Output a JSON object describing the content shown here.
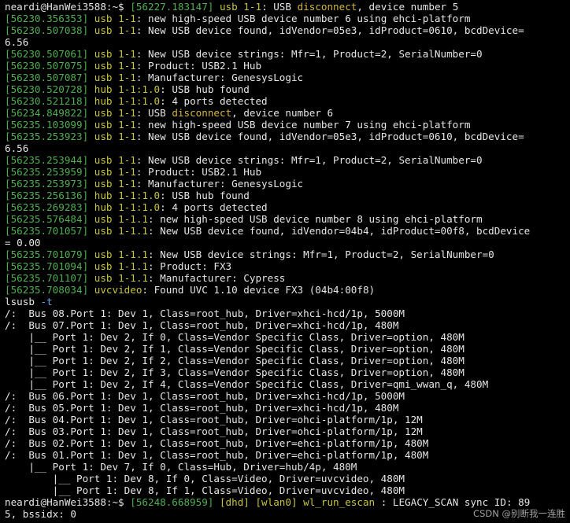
{
  "colors": {
    "background": "#000000",
    "text": "#e6e6e6",
    "timestamp": "#4fae4f",
    "subsystem": "#c8c43a",
    "warning": "#d3b53a",
    "option": "#5aa7e6"
  },
  "terminal": {
    "lines": [
      {
        "kind": "log",
        "segments": [
          {
            "t": "neardi@HanWei3588:~$ ",
            "c": "prompt"
          },
          {
            "t": "[56227.183147]",
            "c": "ts"
          },
          {
            "t": " usb 1-1",
            "c": "sub"
          },
          {
            "t": ": USB ",
            "c": "text"
          },
          {
            "t": "disconnect",
            "c": "warn"
          },
          {
            "t": ", device number 5",
            "c": "text"
          }
        ]
      },
      {
        "kind": "log",
        "segments": [
          {
            "t": "[56230.356353]",
            "c": "ts"
          },
          {
            "t": " usb 1-1",
            "c": "sub"
          },
          {
            "t": ": new high-speed USB device number 6 using ehci-platform",
            "c": "text"
          }
        ]
      },
      {
        "kind": "log",
        "segments": [
          {
            "t": "[56230.507038]",
            "c": "ts"
          },
          {
            "t": " usb 1-1",
            "c": "sub"
          },
          {
            "t": ": New USB device found, idVendor=05e3, idProduct=0610, bcdDevice=",
            "c": "text"
          }
        ]
      },
      {
        "kind": "log",
        "segments": [
          {
            "t": "6.56",
            "c": "text"
          }
        ]
      },
      {
        "kind": "log",
        "segments": [
          {
            "t": "[56230.507061]",
            "c": "ts"
          },
          {
            "t": " usb 1-1",
            "c": "sub"
          },
          {
            "t": ": New USB device strings: Mfr=1, Product=2, SerialNumber=0",
            "c": "text"
          }
        ]
      },
      {
        "kind": "log",
        "segments": [
          {
            "t": "[56230.507075]",
            "c": "ts"
          },
          {
            "t": " usb 1-1",
            "c": "sub"
          },
          {
            "t": ": Product: USB2.1 Hub",
            "c": "text"
          }
        ]
      },
      {
        "kind": "log",
        "segments": [
          {
            "t": "[56230.507087]",
            "c": "ts"
          },
          {
            "t": " usb 1-1",
            "c": "sub"
          },
          {
            "t": ": Manufacturer: GenesysLogic",
            "c": "text"
          }
        ]
      },
      {
        "kind": "log",
        "segments": [
          {
            "t": "[56230.520728]",
            "c": "ts"
          },
          {
            "t": " hub 1-1:1.0",
            "c": "sub"
          },
          {
            "t": ": USB hub found",
            "c": "text"
          }
        ]
      },
      {
        "kind": "log",
        "segments": [
          {
            "t": "[56230.521218]",
            "c": "ts"
          },
          {
            "t": " hub 1-1:1.0",
            "c": "sub"
          },
          {
            "t": ": 4 ports detected",
            "c": "text"
          }
        ]
      },
      {
        "kind": "log",
        "segments": [
          {
            "t": "[56234.849822]",
            "c": "ts"
          },
          {
            "t": " usb 1-1",
            "c": "sub"
          },
          {
            "t": ": USB ",
            "c": "text"
          },
          {
            "t": "disconnect",
            "c": "warn"
          },
          {
            "t": ", device number 6",
            "c": "text"
          }
        ]
      },
      {
        "kind": "log",
        "segments": [
          {
            "t": "[56235.103099]",
            "c": "ts"
          },
          {
            "t": " usb 1-1",
            "c": "sub"
          },
          {
            "t": ": new high-speed USB device number 7 using ehci-platform",
            "c": "text"
          }
        ]
      },
      {
        "kind": "log",
        "segments": [
          {
            "t": "[56235.253923]",
            "c": "ts"
          },
          {
            "t": " usb 1-1",
            "c": "sub"
          },
          {
            "t": ": New USB device found, idVendor=05e3, idProduct=0610, bcdDevice=",
            "c": "text"
          }
        ]
      },
      {
        "kind": "log",
        "segments": [
          {
            "t": "6.56",
            "c": "text"
          }
        ]
      },
      {
        "kind": "log",
        "segments": [
          {
            "t": "[56235.253944]",
            "c": "ts"
          },
          {
            "t": " usb 1-1",
            "c": "sub"
          },
          {
            "t": ": New USB device strings: Mfr=1, Product=2, SerialNumber=0",
            "c": "text"
          }
        ]
      },
      {
        "kind": "log",
        "segments": [
          {
            "t": "[56235.253959]",
            "c": "ts"
          },
          {
            "t": " usb 1-1",
            "c": "sub"
          },
          {
            "t": ": Product: USB2.1 Hub",
            "c": "text"
          }
        ]
      },
      {
        "kind": "log",
        "segments": [
          {
            "t": "[56235.253973]",
            "c": "ts"
          },
          {
            "t": " usb 1-1",
            "c": "sub"
          },
          {
            "t": ": Manufacturer: GenesysLogic",
            "c": "text"
          }
        ]
      },
      {
        "kind": "log",
        "segments": [
          {
            "t": "[56235.256136]",
            "c": "ts"
          },
          {
            "t": " hub 1-1:1.0",
            "c": "sub"
          },
          {
            "t": ": USB hub found",
            "c": "text"
          }
        ]
      },
      {
        "kind": "log",
        "segments": [
          {
            "t": "[56235.269283]",
            "c": "ts"
          },
          {
            "t": " hub 1-1:1.0",
            "c": "sub"
          },
          {
            "t": ": 4 ports detected",
            "c": "text"
          }
        ]
      },
      {
        "kind": "log",
        "segments": [
          {
            "t": "[56235.576484]",
            "c": "ts"
          },
          {
            "t": " usb 1-1.1",
            "c": "sub"
          },
          {
            "t": ": new high-speed USB device number 8 using ehci-platform",
            "c": "text"
          }
        ]
      },
      {
        "kind": "log",
        "segments": [
          {
            "t": "[56235.701057]",
            "c": "ts"
          },
          {
            "t": " usb 1-1.1",
            "c": "sub"
          },
          {
            "t": ": New USB device found, idVendor=04b4, idProduct=00f8, bcdDevice",
            "c": "text"
          }
        ]
      },
      {
        "kind": "log",
        "segments": [
          {
            "t": "= 0.00",
            "c": "text"
          }
        ]
      },
      {
        "kind": "log",
        "segments": [
          {
            "t": "[56235.701079]",
            "c": "ts"
          },
          {
            "t": " usb 1-1.1",
            "c": "sub"
          },
          {
            "t": ": New USB device strings: Mfr=1, Product=2, SerialNumber=0",
            "c": "text"
          }
        ]
      },
      {
        "kind": "log",
        "segments": [
          {
            "t": "[56235.701094]",
            "c": "ts"
          },
          {
            "t": " usb 1-1.1",
            "c": "sub"
          },
          {
            "t": ": Product: FX3",
            "c": "text"
          }
        ]
      },
      {
        "kind": "log",
        "segments": [
          {
            "t": "[56235.701107]",
            "c": "ts"
          },
          {
            "t": " usb 1-1.1",
            "c": "sub"
          },
          {
            "t": ": Manufacturer: Cypress",
            "c": "text"
          }
        ]
      },
      {
        "kind": "log",
        "segments": [
          {
            "t": "[56235.708034]",
            "c": "ts"
          },
          {
            "t": " uvcvideo",
            "c": "sub"
          },
          {
            "t": ": Found UVC 1.10 device FX3 (04b4:00f8)",
            "c": "text"
          }
        ]
      },
      {
        "kind": "cmd",
        "segments": [
          {
            "t": "lsusb ",
            "c": "text"
          },
          {
            "t": "-t",
            "c": "opt"
          }
        ]
      },
      {
        "kind": "out",
        "segments": [
          {
            "t": "/:  Bus 08.Port 1: Dev 1, Class=root_hub, Driver=xhci-hcd/1p, 5000M",
            "c": "text"
          }
        ]
      },
      {
        "kind": "out",
        "segments": [
          {
            "t": "/:  Bus 07.Port 1: Dev 1, Class=root_hub, Driver=xhci-hcd/1p, 480M",
            "c": "text"
          }
        ]
      },
      {
        "kind": "out",
        "segments": [
          {
            "t": "    |__ Port 1: Dev 2, If 0, Class=Vendor Specific Class, Driver=option, 480M",
            "c": "text"
          }
        ]
      },
      {
        "kind": "out",
        "segments": [
          {
            "t": "    |__ Port 1: Dev 2, If 1, Class=Vendor Specific Class, Driver=option, 480M",
            "c": "text"
          }
        ]
      },
      {
        "kind": "out",
        "segments": [
          {
            "t": "    |__ Port 1: Dev 2, If 2, Class=Vendor Specific Class, Driver=option, 480M",
            "c": "text"
          }
        ]
      },
      {
        "kind": "out",
        "segments": [
          {
            "t": "    |__ Port 1: Dev 2, If 3, Class=Vendor Specific Class, Driver=option, 480M",
            "c": "text"
          }
        ]
      },
      {
        "kind": "out",
        "segments": [
          {
            "t": "    |__ Port 1: Dev 2, If 4, Class=Vendor Specific Class, Driver=qmi_wwan_q, 480M",
            "c": "text"
          }
        ]
      },
      {
        "kind": "out",
        "segments": [
          {
            "t": "/:  Bus 06.Port 1: Dev 1, Class=root_hub, Driver=xhci-hcd/1p, 5000M",
            "c": "text"
          }
        ]
      },
      {
        "kind": "out",
        "segments": [
          {
            "t": "/:  Bus 05.Port 1: Dev 1, Class=root_hub, Driver=xhci-hcd/1p, 480M",
            "c": "text"
          }
        ]
      },
      {
        "kind": "out",
        "segments": [
          {
            "t": "/:  Bus 04.Port 1: Dev 1, Class=root_hub, Driver=ohci-platform/1p, 12M",
            "c": "text"
          }
        ]
      },
      {
        "kind": "out",
        "segments": [
          {
            "t": "/:  Bus 03.Port 1: Dev 1, Class=root_hub, Driver=ohci-platform/1p, 12M",
            "c": "text"
          }
        ]
      },
      {
        "kind": "out",
        "segments": [
          {
            "t": "/:  Bus 02.Port 1: Dev 1, Class=root_hub, Driver=ehci-platform/1p, 480M",
            "c": "text"
          }
        ]
      },
      {
        "kind": "out",
        "segments": [
          {
            "t": "/:  Bus 01.Port 1: Dev 1, Class=root_hub, Driver=ehci-platform/1p, 480M",
            "c": "text"
          }
        ]
      },
      {
        "kind": "out",
        "segments": [
          {
            "t": "    |__ Port 1: Dev 7, If 0, Class=Hub, Driver=hub/4p, 480M",
            "c": "text"
          }
        ]
      },
      {
        "kind": "out",
        "segments": [
          {
            "t": "        |__ Port 1: Dev 8, If 0, Class=Video, Driver=uvcvideo, 480M",
            "c": "text"
          }
        ]
      },
      {
        "kind": "out",
        "segments": [
          {
            "t": "        |__ Port 1: Dev 8, If 1, Class=Video, Driver=uvcvideo, 480M",
            "c": "text"
          }
        ]
      },
      {
        "kind": "log",
        "segments": [
          {
            "t": "neardi@HanWei3588:~$ ",
            "c": "prompt"
          },
          {
            "t": "[56248.668959]",
            "c": "ts"
          },
          {
            "t": " [dhd]",
            "c": "sub"
          },
          {
            "t": " [wlan0]",
            "c": "sub"
          },
          {
            "t": " wl_run_escan",
            "c": "sub"
          },
          {
            "t": " : LEGACY_SCAN sync ID: 89",
            "c": "text"
          }
        ]
      },
      {
        "kind": "log",
        "segments": [
          {
            "t": "5, bssidx: 0",
            "c": "text"
          }
        ]
      }
    ]
  },
  "watermark": {
    "text": "CSDN @别断我一连胜"
  }
}
